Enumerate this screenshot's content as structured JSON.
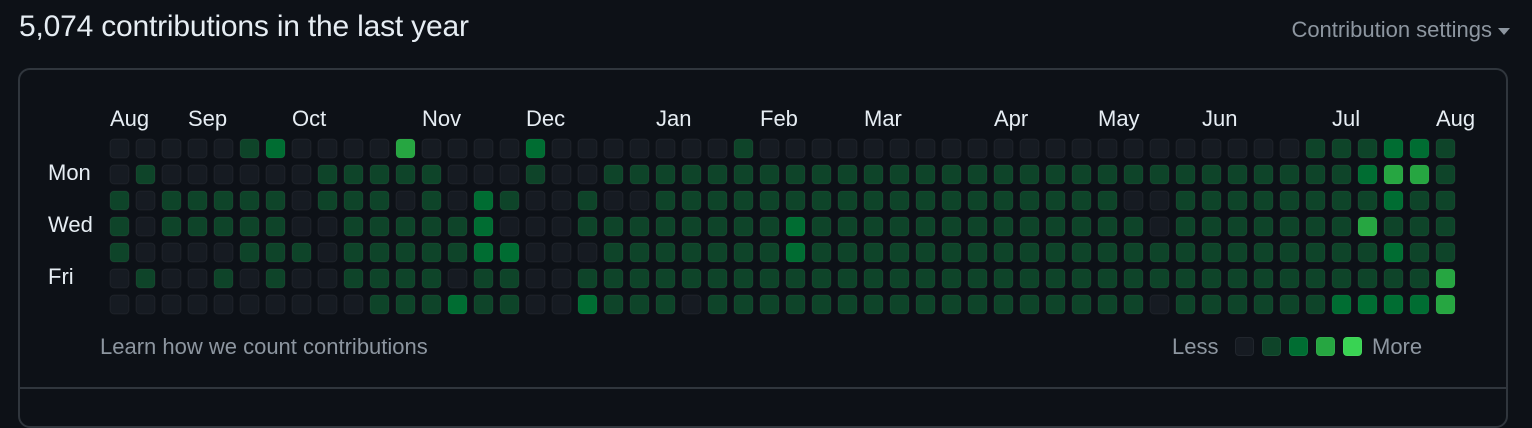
{
  "header": {
    "title": "5,074 contributions in the last year",
    "settings_label": "Contribution settings"
  },
  "calendar": {
    "months": [
      "Aug",
      "Sep",
      "Oct",
      "Nov",
      "Dec",
      "Jan",
      "Feb",
      "Mar",
      "Apr",
      "May",
      "Jun",
      "Jul",
      "Aug"
    ],
    "month_start_week": [
      0,
      3,
      7,
      12,
      16,
      21,
      25,
      29,
      34,
      38,
      42,
      47,
      51
    ],
    "day_labels": [
      "Mon",
      "Wed",
      "Fri"
    ],
    "day_label_rows": [
      1,
      3,
      5
    ],
    "colors": [
      "#161b22",
      "#0e4429",
      "#006d32",
      "#26a641",
      "#39d353"
    ],
    "levels": [
      "0000012000030000200000001000000000000000000000111221",
      "0100000011111000100111111111111111111111111111112331",
      "1011111011101021001001111111111111111110011111111211",
      "1011111001111120001111111121111111111111011111113111",
      "1000011101111122000111111121111111111111111111111211",
      "0100101001111011001111111111111111111111111111111113",
      "0000000000111211002111011111111111111111011111122223"
    ]
  },
  "footer": {
    "learn_link": "Learn how we count contributions",
    "less_label": "Less",
    "more_label": "More"
  }
}
